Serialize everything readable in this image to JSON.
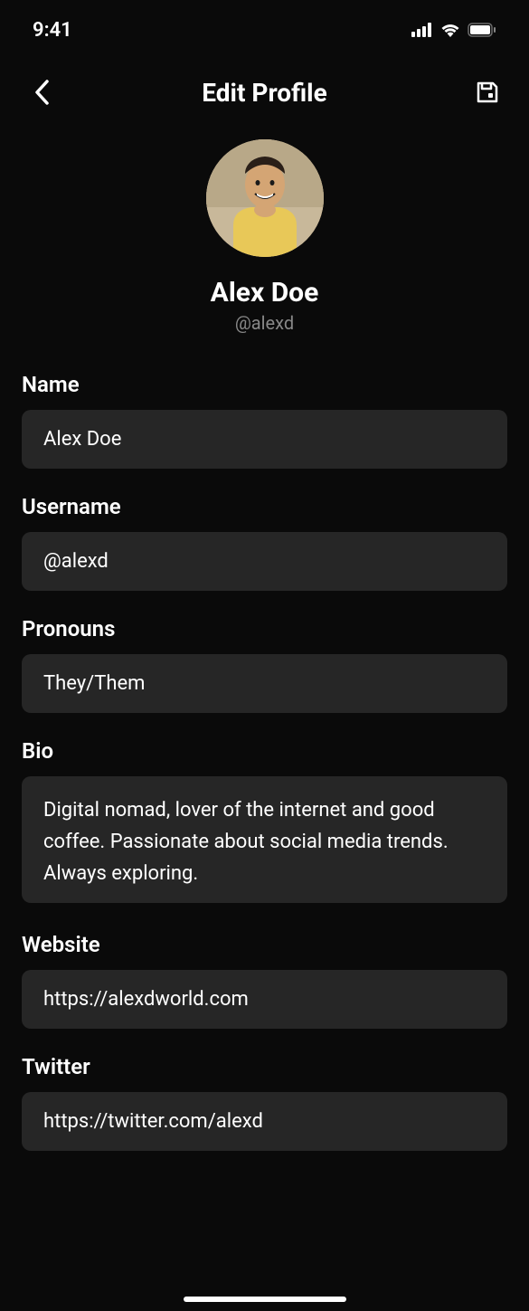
{
  "status_bar": {
    "time": "9:41"
  },
  "header": {
    "title": "Edit Profile"
  },
  "profile": {
    "display_name": "Alex Doe",
    "handle": "@alexd"
  },
  "fields": {
    "name": {
      "label": "Name",
      "value": "Alex Doe"
    },
    "username": {
      "label": "Username",
      "value": "@alexd"
    },
    "pronouns": {
      "label": "Pronouns",
      "value": "They/Them"
    },
    "bio": {
      "label": "Bio",
      "value": "Digital nomad, lover of the internet and good coffee. Passionate about social media trends. Always exploring."
    },
    "website": {
      "label": "Website",
      "value": "https://alexdworld.com"
    },
    "twitter": {
      "label": "Twitter",
      "value": "https://twitter.com/alexd"
    }
  }
}
